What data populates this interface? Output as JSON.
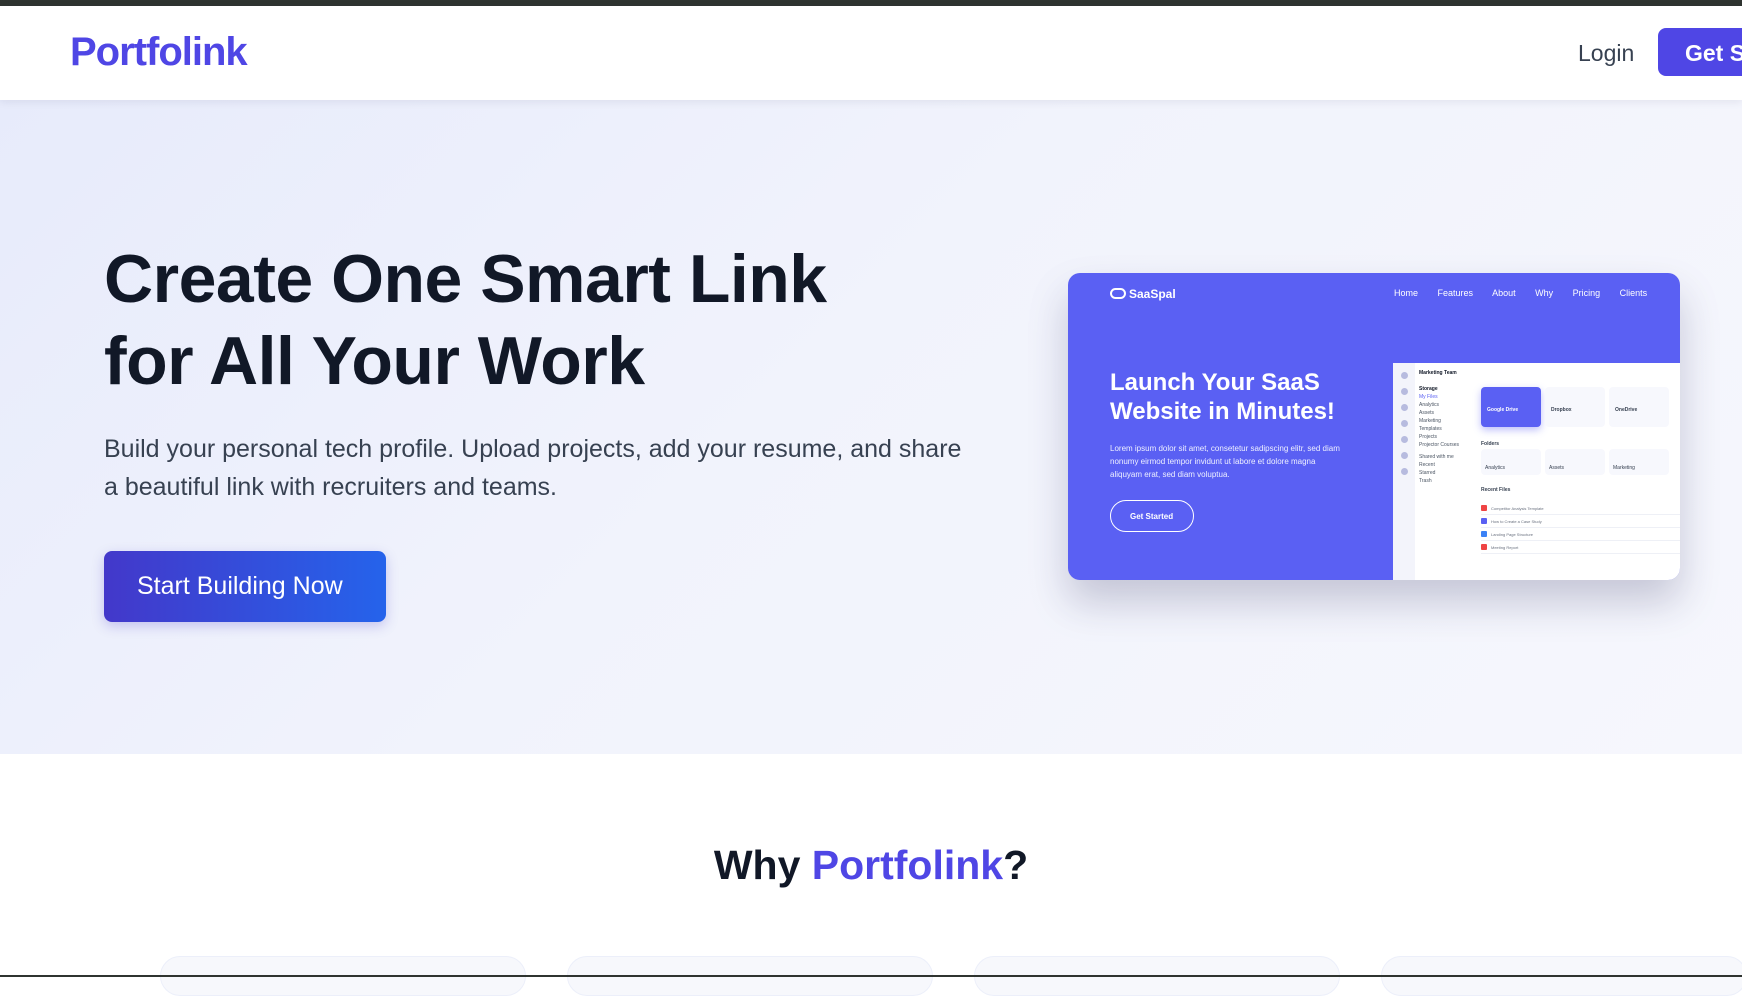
{
  "nav": {
    "logo": "Portfolink",
    "login": "Login",
    "cta": "Get S"
  },
  "hero": {
    "title_line1": "Create One Smart Link",
    "title_line2": "for All Your Work",
    "subtitle": "Build your personal tech profile. Upload projects, add your resume, and share a beautiful link with recruiters and teams.",
    "button": "Start Building Now",
    "preview": {
      "brand": "SaaSpal",
      "nav_items": [
        "Home",
        "Features",
        "About",
        "Why",
        "Pricing",
        "Clients"
      ],
      "headline": "Launch Your SaaS Website in Minutes!",
      "body": "Lorem ipsum dolor sit amet, consetetur sadipscing elitr, sed diam nonumy eirmod tempor invidunt ut labore et dolore magna aliquyam erat, sed diam voluptua.",
      "button": "Get Started",
      "dashboard": {
        "team": "Marketing Team",
        "storage": "Storage",
        "my_files": "My Files",
        "tree": [
          "Analytics",
          "Assets",
          "Marketing",
          "Templates",
          "Projects",
          "Projector Courses"
        ],
        "links": [
          "Shared with me",
          "Recent",
          "Starred",
          "Trash"
        ],
        "cards": [
          "Google Drive",
          "Dropbox",
          "OneDrive"
        ],
        "folders_label": "Folders",
        "folders": [
          "Analytics",
          "Assets",
          "Marketing"
        ],
        "recent_label": "Recent Files",
        "recent": [
          "Competitor Analysis Template",
          "How to Create a Case Study",
          "Landing Page Structure",
          "Meeting Report"
        ]
      }
    }
  },
  "why": {
    "prefix": "Why ",
    "accent": "Portfolink",
    "suffix": "?"
  },
  "colors": {
    "brand": "#4f46e5",
    "preview_bg": "#5a60f3",
    "text_dark": "#111827"
  }
}
